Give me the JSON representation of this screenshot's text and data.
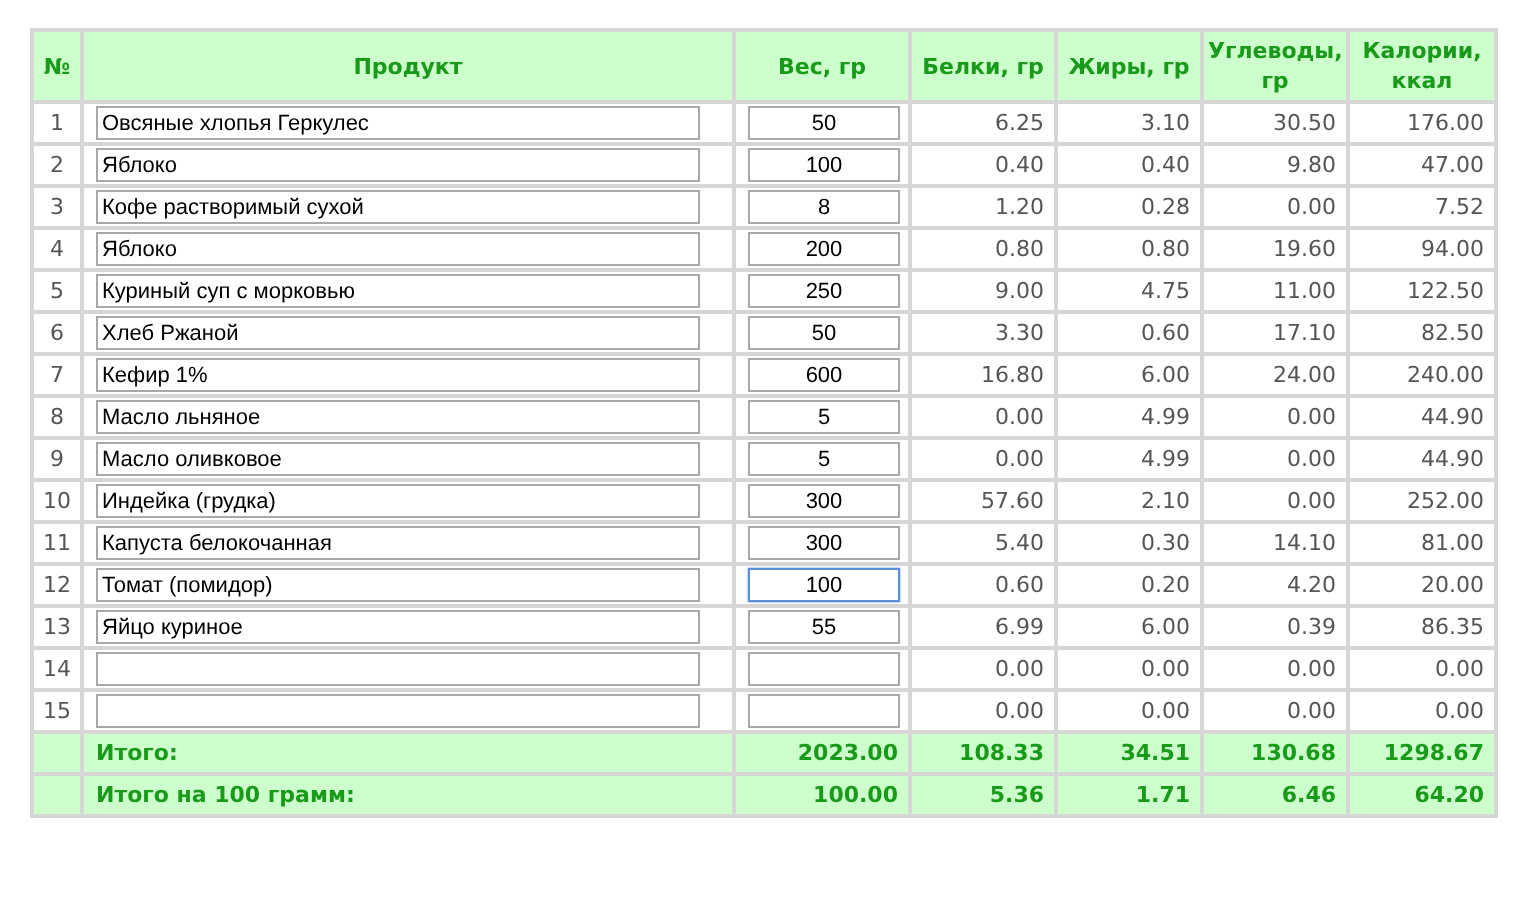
{
  "table": {
    "columns": [
      "№",
      "Продукт",
      "Вес, гр",
      "Белки, гр",
      "Жиры, гр",
      "Углеводы, гр",
      "Калории, ккал"
    ],
    "rows": [
      {
        "number": "1",
        "product": "Овсяные хлопья Геркулес",
        "weight": "50",
        "focused": false,
        "protein": "6.25",
        "fat": "3.10",
        "carbs": "30.50",
        "calories": "176.00"
      },
      {
        "number": "2",
        "product": "Яблоко",
        "weight": "100",
        "focused": false,
        "protein": "0.40",
        "fat": "0.40",
        "carbs": "9.80",
        "calories": "47.00"
      },
      {
        "number": "3",
        "product": "Кофе растворимый сухой",
        "weight": "8",
        "focused": false,
        "protein": "1.20",
        "fat": "0.28",
        "carbs": "0.00",
        "calories": "7.52"
      },
      {
        "number": "4",
        "product": "Яблоко",
        "weight": "200",
        "focused": false,
        "protein": "0.80",
        "fat": "0.80",
        "carbs": "19.60",
        "calories": "94.00"
      },
      {
        "number": "5",
        "product": "Куриный суп с морковью",
        "weight": "250",
        "focused": false,
        "protein": "9.00",
        "fat": "4.75",
        "carbs": "11.00",
        "calories": "122.50"
      },
      {
        "number": "6",
        "product": "Хлеб Ржаной",
        "weight": "50",
        "focused": false,
        "protein": "3.30",
        "fat": "0.60",
        "carbs": "17.10",
        "calories": "82.50"
      },
      {
        "number": "7",
        "product": "Кефир 1%",
        "weight": "600",
        "focused": false,
        "protein": "16.80",
        "fat": "6.00",
        "carbs": "24.00",
        "calories": "240.00"
      },
      {
        "number": "8",
        "product": "Масло льняное",
        "weight": "5",
        "focused": false,
        "protein": "0.00",
        "fat": "4.99",
        "carbs": "0.00",
        "calories": "44.90"
      },
      {
        "number": "9",
        "product": "Масло оливковое",
        "weight": "5",
        "focused": false,
        "protein": "0.00",
        "fat": "4.99",
        "carbs": "0.00",
        "calories": "44.90"
      },
      {
        "number": "10",
        "product": "Индейка (грудка)",
        "weight": "300",
        "focused": false,
        "protein": "57.60",
        "fat": "2.10",
        "carbs": "0.00",
        "calories": "252.00"
      },
      {
        "number": "11",
        "product": "Капуста белокочанная",
        "weight": "300",
        "focused": false,
        "protein": "5.40",
        "fat": "0.30",
        "carbs": "14.10",
        "calories": "81.00"
      },
      {
        "number": "12",
        "product": "Томат (помидор)",
        "weight": "100",
        "focused": true,
        "protein": "0.60",
        "fat": "0.20",
        "carbs": "4.20",
        "calories": "20.00"
      },
      {
        "number": "13",
        "product": "Яйцо куриное",
        "weight": "55",
        "focused": false,
        "protein": "6.99",
        "fat": "6.00",
        "carbs": "0.39",
        "calories": "86.35"
      },
      {
        "number": "14",
        "focused": false,
        "protein": "0.00",
        "fat": "0.00",
        "carbs": "0.00",
        "calories": "0.00"
      },
      {
        "number": "15",
        "focused": false,
        "protein": "0.00",
        "fat": "0.00",
        "carbs": "0.00",
        "calories": "0.00"
      }
    ],
    "totals": [
      {
        "label": "Итого:",
        "weight": "2023.00",
        "protein": "108.33",
        "fat": "34.51",
        "carbs": "130.68",
        "calories": "1298.67"
      },
      {
        "label": "Итого на 100 грамм:",
        "weight": "100.00",
        "protein": "5.36",
        "fat": "1.71",
        "carbs": "6.46",
        "calories": "64.20"
      }
    ]
  }
}
